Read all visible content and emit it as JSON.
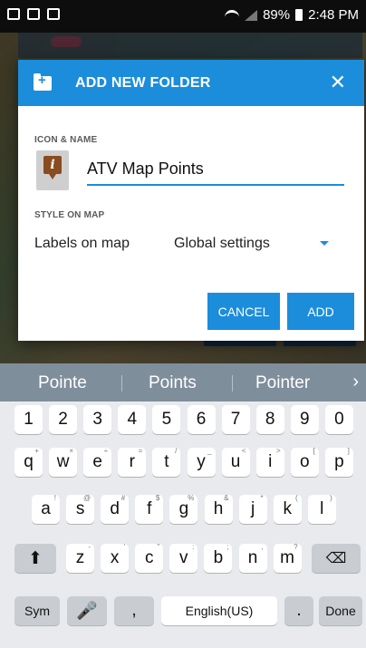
{
  "status_bar": {
    "battery": "89%",
    "time": "2:48 PM"
  },
  "dialog": {
    "title": "ADD NEW FOLDER",
    "close_label": "✕",
    "icon_name_label": "ICON & NAME",
    "name_value": "ATV Map Points",
    "style_on_map_label": "STYLE ON MAP",
    "labels_on_map": "Labels on map",
    "labels_selected": "Global settings",
    "cancel_label": "CANCEL",
    "add_label": "ADD",
    "accent": "#1c8ddb"
  },
  "keyboard": {
    "suggestions": [
      "Pointe",
      "Points",
      "Pointer"
    ],
    "numbers": [
      "1",
      "2",
      "3",
      "4",
      "5",
      "6",
      "7",
      "8",
      "9",
      "0"
    ],
    "row1": [
      "q",
      "w",
      "e",
      "r",
      "t",
      "y",
      "u",
      "i",
      "o",
      "p"
    ],
    "row1_hints": [
      "+",
      "×",
      "÷",
      "=",
      "/",
      "_",
      "<",
      ">",
      "[",
      "]"
    ],
    "row2": [
      "a",
      "s",
      "d",
      "f",
      "g",
      "h",
      "j",
      "k",
      "l"
    ],
    "row2_hints": [
      "!",
      "@",
      "#",
      "$",
      "%",
      "&",
      "*",
      "(",
      ")"
    ],
    "row3": [
      "z",
      "x",
      "c",
      "v",
      "b",
      "n",
      "m"
    ],
    "row3_hints": [
      "-",
      "'",
      "\"",
      ":",
      ";",
      ",",
      "?"
    ],
    "sym_label": "Sym",
    "comma": ",",
    "space_label": "English(US)",
    "period": ".",
    "done_label": "Done"
  }
}
